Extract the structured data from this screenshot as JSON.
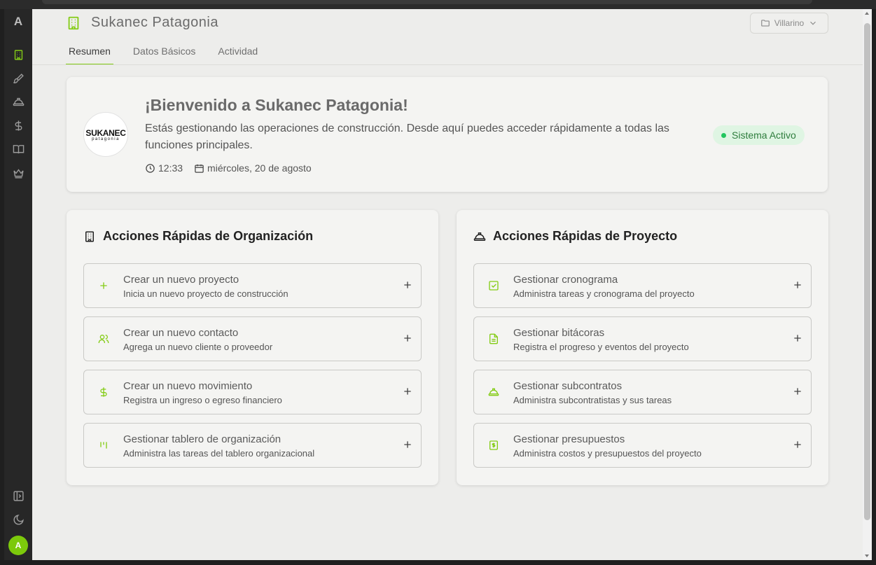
{
  "colors": {
    "accent": "#84cc16",
    "status_bg": "#dff5e3",
    "status_text": "#2e7d3d",
    "sidebar_bg": "#272727",
    "page_bg": "#ededeb"
  },
  "sidebar": {
    "logo": "A",
    "items": [
      {
        "icon": "building-icon",
        "active": true
      },
      {
        "icon": "brush-icon"
      },
      {
        "icon": "hard-hat-icon"
      },
      {
        "icon": "dollar-icon"
      },
      {
        "icon": "book-icon"
      },
      {
        "icon": "crown-icon"
      }
    ],
    "bottom": [
      {
        "icon": "panel-toggle-icon"
      },
      {
        "icon": "moon-icon"
      }
    ],
    "avatar_initial": "A"
  },
  "header": {
    "title": "Sukanec Patagonia",
    "org_select": "Villarino"
  },
  "tabs": [
    {
      "label": "Resumen",
      "active": true
    },
    {
      "label": "Datos Básicos"
    },
    {
      "label": "Actividad"
    }
  ],
  "welcome": {
    "logo_line1": "SUKANEC",
    "logo_line2": "patagonia",
    "title": "¡Bienvenido a Sukanec Patagonia!",
    "description": "Estás gestionando las operaciones de construcción. Desde aquí puedes acceder rápidamente a todas las funciones principales.",
    "time": "12:33",
    "date": "miércoles, 20 de agosto",
    "status": "Sistema Activo"
  },
  "org_panel": {
    "title": "Acciones Rápidas de Organización",
    "actions": [
      {
        "icon": "plus-icon",
        "title": "Crear un nuevo proyecto",
        "subtitle": "Inicia un nuevo proyecto de construcción"
      },
      {
        "icon": "users-icon",
        "title": "Crear un nuevo contacto",
        "subtitle": "Agrega un nuevo cliente o proveedor"
      },
      {
        "icon": "dollar-icon",
        "title": "Crear un nuevo movimiento",
        "subtitle": "Registra un ingreso o egreso financiero"
      },
      {
        "icon": "kanban-icon",
        "title": "Gestionar tablero de organización",
        "subtitle": "Administra las tareas del tablero organizacional"
      }
    ]
  },
  "project_panel": {
    "title": "Acciones Rápidas de Proyecto",
    "actions": [
      {
        "icon": "calendar-check-icon",
        "title": "Gestionar cronograma",
        "subtitle": "Administra tareas y cronograma del proyecto"
      },
      {
        "icon": "file-text-icon",
        "title": "Gestionar bitácoras",
        "subtitle": "Registra el progreso y eventos del proyecto"
      },
      {
        "icon": "hard-hat-icon",
        "title": "Gestionar subcontratos",
        "subtitle": "Administra subcontratistas y sus tareas"
      },
      {
        "icon": "receipt-dollar-icon",
        "title": "Gestionar presupuestos",
        "subtitle": "Administra costos y presupuestos del proyecto"
      }
    ]
  }
}
